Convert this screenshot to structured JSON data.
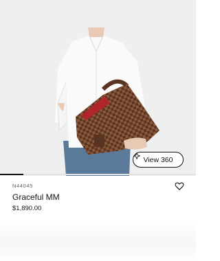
{
  "product": {
    "sku": "N44045",
    "name": "Graceful MM",
    "price": "$1,890.00"
  },
  "gallery": {
    "view360_label": "View 360",
    "view360_icon": "rotate-360-icon",
    "progress_fraction": 0.12
  },
  "wishlist": {
    "icon": "heart-icon"
  },
  "colors": {
    "text": "#19110b",
    "background": "#efefef",
    "accent": "#19110b"
  }
}
